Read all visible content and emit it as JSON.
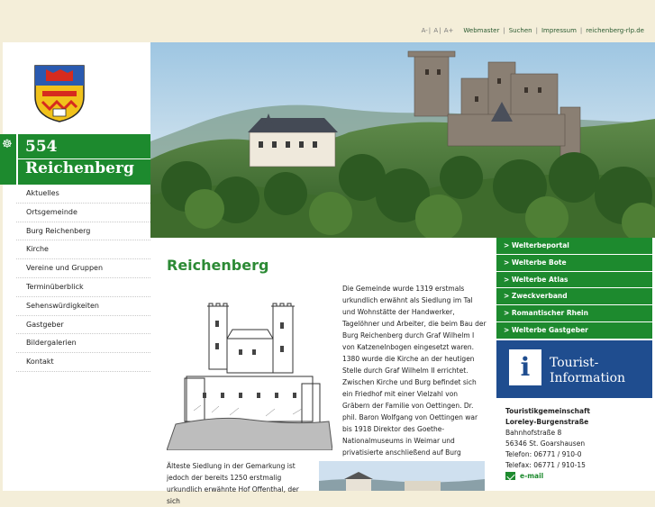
{
  "utility": {
    "sizes": [
      "A-",
      "A",
      "A+"
    ],
    "links": [
      "Webmaster",
      "Suchen",
      "Impressum",
      "reichenberg-rlp.de"
    ]
  },
  "banner": {
    "number": "554",
    "town": "Reichenberg",
    "compass_icon": "compass-icon"
  },
  "nav": [
    "Aktuelles",
    "Ortsgemeinde",
    "Burg Reichenberg",
    "Kirche",
    "Vereine und Gruppen",
    "Terminüberblick",
    "Sehenswürdigkeiten",
    "Gastgeber",
    "Bildergalerien",
    "Kontakt"
  ],
  "main": {
    "heading": "Reichenberg",
    "text1": "Die Gemeinde wurde 1319 erstmals urkundlich erwähnt als Siedlung im Tal und Wohnstätte der Handwerker, Tagelöhner und Arbeiter, die beim Bau der Burg Reichenberg durch Graf Wilhelm I von Katzenelnbogen eingesetzt waren. 1380 wurde die Kirche an der heutigen Stelle durch Graf Wilhelm II errichtet. Zwischen Kirche und Burg befindet sich ein Friedhof mit einer Vielzahl von Gräbern der Familie von Oettingen. Dr. phil. Baron Wolfgang von Oettingen war bis 1918 Direktor des Goethe-Nationalmuseums in Weimar und privatisierte anschließend auf Burg Reichenberg.",
    "text2": "Älteste Siedlung in der Gemarkung ist jedoch der bereits 1250 erstmalig urkundlich erwähnte Hof Offenthal, der sich"
  },
  "right_nav": [
    "> Welterbeportal",
    "> Welterbe Bote",
    "> Welterbe Atlas",
    "> Zweckverband",
    "> Romantischer Rhein",
    "> Welterbe Gastgeber"
  ],
  "tourist": {
    "line1": "Tourist-",
    "line2": "Information",
    "icon": "info-icon"
  },
  "contact": {
    "org1": "Touristikgemeinschaft",
    "org2": "Loreley-Burgenstraße",
    "street": "Bahnhofstraße 8",
    "city": "56346 St. Goarshausen",
    "phone": "Telefon: 06771 / 910-0",
    "fax": "Telefax: 06771 / 910-15",
    "email": "e-mail"
  },
  "colors": {
    "green": "#1d8a2e",
    "blue": "#1f4d8f",
    "cream": "#f4eed9"
  }
}
